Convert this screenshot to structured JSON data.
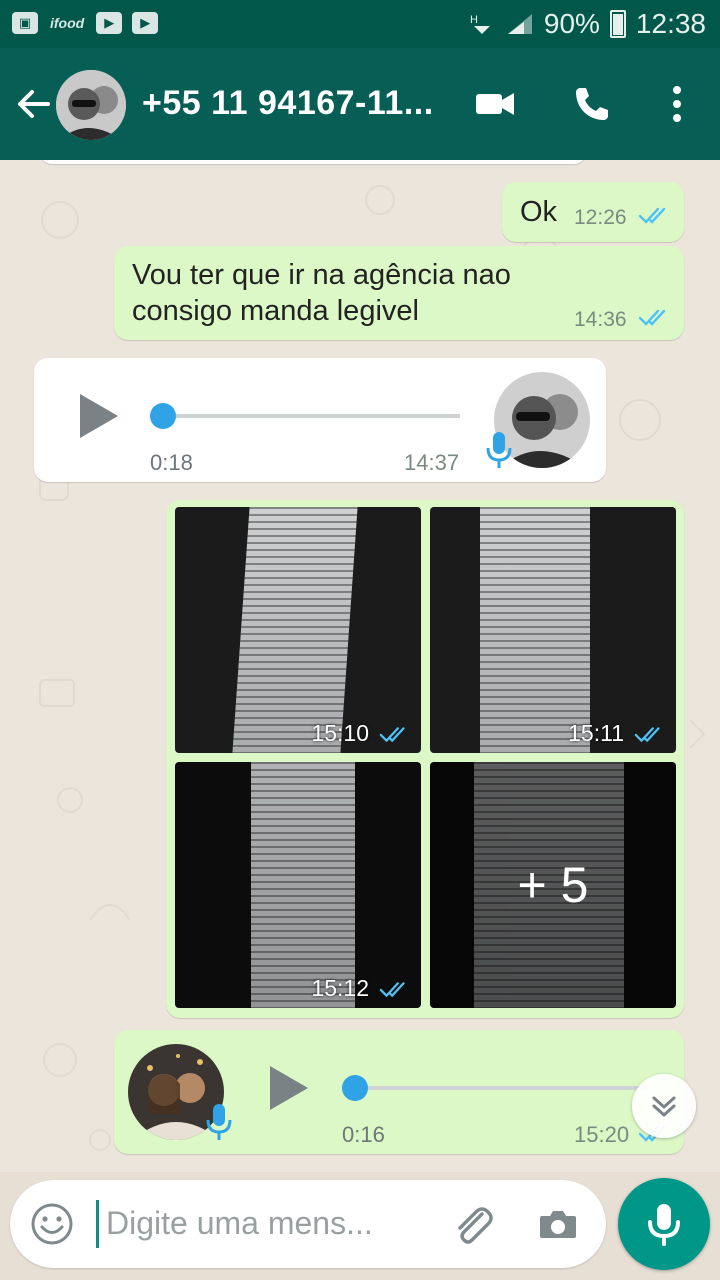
{
  "status_bar": {
    "ifood_label": "ifood",
    "battery": "90%",
    "time": "12:38"
  },
  "header": {
    "contact": "+55 11 94167-11..."
  },
  "messages": [
    {
      "type": "text",
      "direction": "outgoing",
      "text": "Ok",
      "time": "12:26"
    },
    {
      "type": "text",
      "direction": "outgoing",
      "text_lines": [
        "Vou ter que ir na agência nao",
        "consigo manda legivel"
      ],
      "time": "14:36"
    },
    {
      "type": "voice",
      "direction": "incoming",
      "duration": "0:18",
      "time": "14:37",
      "progress": 0
    },
    {
      "type": "photos",
      "direction": "outgoing",
      "items": [
        {
          "time": "15:10"
        },
        {
          "time": "15:11"
        },
        {
          "time": "15:12"
        },
        {
          "more": "+ 5"
        }
      ]
    },
    {
      "type": "voice",
      "direction": "outgoing",
      "duration": "0:16",
      "time": "15:20",
      "progress": 0
    }
  ],
  "input": {
    "placeholder": "Digite uma mens..."
  },
  "colors": {
    "header": "#075e54",
    "status_bar": "#00574a",
    "outgoing_bubble": "#dcf8c6",
    "incoming_bubble": "#ffffff",
    "read_ticks": "#4fc3f7",
    "fab": "#009688"
  },
  "icons": [
    "back-arrow-icon",
    "video-call-icon",
    "phone-icon",
    "more-options-icon",
    "play-icon",
    "mic-icon",
    "emoji-icon",
    "attach-icon",
    "camera-icon",
    "chevron-down-icon",
    "read-ticks-icon"
  ]
}
